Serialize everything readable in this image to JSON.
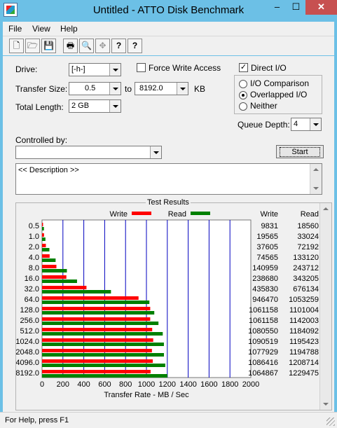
{
  "window": {
    "title": "Untitled - ATTO Disk Benchmark",
    "minimize": "–",
    "maximize": "☐",
    "close": "✕"
  },
  "menu": [
    "File",
    "View",
    "Help"
  ],
  "toolbar_icons": [
    "new-icon",
    "open-icon",
    "save-icon",
    "print-icon",
    "print-preview-icon",
    "move-icon",
    "help-icon",
    "context-help-icon"
  ],
  "toolbar_glyphs": [
    "🗋",
    "🗁",
    "💾",
    "🖶",
    "🔍",
    "✥",
    "?",
    "?"
  ],
  "form": {
    "drive_label": "Drive:",
    "drive_value": "[-h-]",
    "force_write_label": "Force Write Access",
    "force_write_checked": false,
    "direct_io_label": "Direct I/O",
    "direct_io_checked": true,
    "direct_io_mark": "✓",
    "transfer_size_label": "Transfer Size:",
    "transfer_from": "0.5",
    "to_label": "to",
    "transfer_to": "8192.0",
    "kb_label": "KB",
    "total_length_label": "Total Length:",
    "total_length": "2 GB",
    "io_options": [
      "I/O Comparison",
      "Overlapped I/O",
      "Neither"
    ],
    "io_selected": "Overlapped I/O",
    "queue_depth_label": "Queue Depth:",
    "queue_depth": "4",
    "controlled_by_label": "Controlled by:",
    "controlled_by_value": "",
    "start_button": "Start",
    "description_text": "<< Description >>"
  },
  "chart_data": {
    "type": "bar",
    "orientation": "horizontal",
    "title": "Test Results",
    "xlabel": "Transfer Rate - MB / Sec",
    "xlim": [
      0,
      2000
    ],
    "xticks": [
      0,
      200,
      400,
      600,
      800,
      1000,
      1200,
      1400,
      1600,
      1800,
      2000
    ],
    "categories": [
      "0.5",
      "1.0",
      "2.0",
      "4.0",
      "8.0",
      "16.0",
      "32.0",
      "64.0",
      "128.0",
      "256.0",
      "512.0",
      "1024.0",
      "2048.0",
      "4096.0",
      "8192.0"
    ],
    "series": [
      {
        "name": "Write",
        "color": "#ff0000",
        "values": [
          9.6,
          19.1,
          36.7,
          72.8,
          137.6,
          233.1,
          425.6,
          924.3,
          1036.3,
          1036.3,
          1055.2,
          1064.9,
          1052.7,
          1060.9,
          1039.9
        ]
      },
      {
        "name": "Read",
        "color": "#008000",
        "values": [
          18.1,
          32.3,
          70.5,
          130.0,
          238.0,
          335.2,
          660.3,
          1028.4,
          1075.2,
          1115.2,
          1156.4,
          1167.4,
          1167.7,
          1180.4,
          1200.7
        ]
      }
    ],
    "table_headers": [
      "Write",
      "Read"
    ],
    "write_values": [
      "9831",
      "19565",
      "37605",
      "74565",
      "140959",
      "238680",
      "435830",
      "946470",
      "1061158",
      "1061158",
      "1080550",
      "1090519",
      "1077929",
      "1086416",
      "1064867"
    ],
    "read_values": [
      "18560",
      "33024",
      "72192",
      "133120",
      "243712",
      "343205",
      "676134",
      "1053259",
      "1101004",
      "1142003",
      "1184092",
      "1195423",
      "1194788",
      "1208714",
      "1229475"
    ],
    "grid_color": "#0000c0",
    "legend": "top"
  },
  "status": {
    "text": "For Help, press F1"
  }
}
